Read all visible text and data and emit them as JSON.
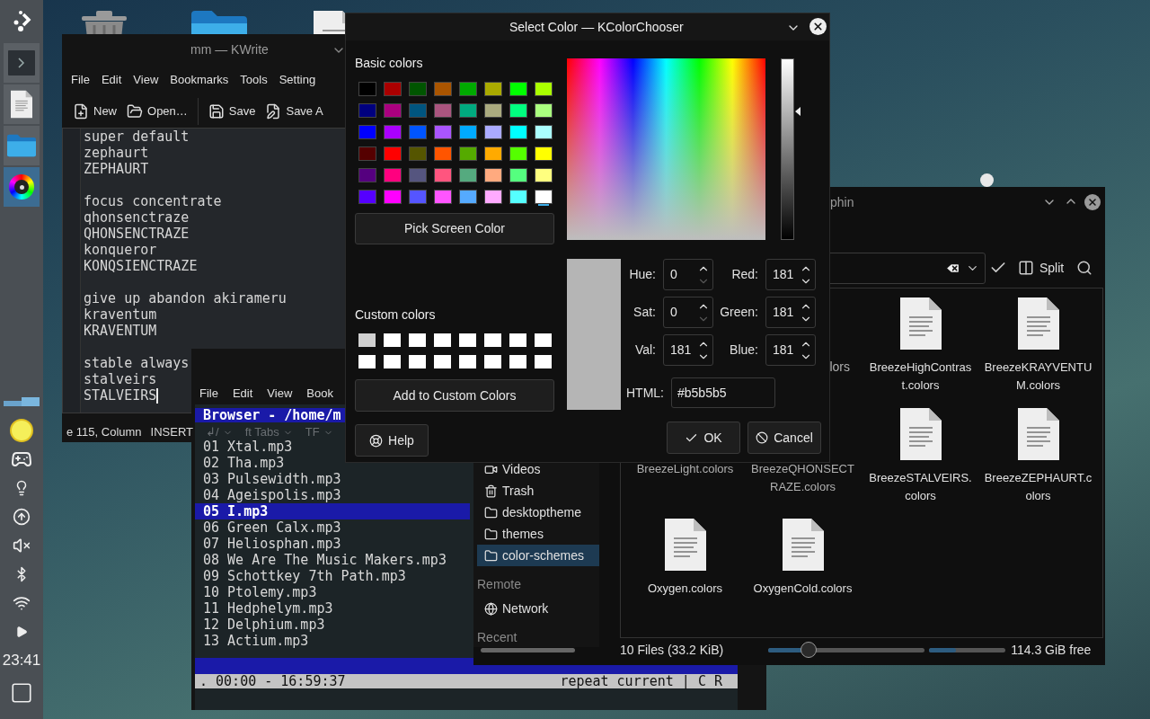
{
  "desktop_icons": [
    {
      "kind": "trash"
    },
    {
      "kind": "folder"
    },
    {
      "kind": "document"
    }
  ],
  "panel": {
    "launchers": [
      {
        "kind": "terminal",
        "active": false
      },
      {
        "kind": "text-editor",
        "active": false
      },
      {
        "kind": "folder",
        "active": false
      },
      {
        "kind": "color-chooser",
        "active": true
      }
    ],
    "tray": [
      {
        "kind": "meter"
      },
      {
        "kind": "night-light"
      },
      {
        "kind": "gamepad"
      },
      {
        "kind": "bulb"
      },
      {
        "kind": "update"
      },
      {
        "kind": "volume-muted"
      },
      {
        "kind": "bluetooth"
      },
      {
        "kind": "wifi"
      },
      {
        "kind": "expand"
      }
    ],
    "clock": "23:41"
  },
  "kwrite": {
    "title": "mm — KWrite",
    "menu": [
      "File",
      "Edit",
      "View",
      "Bookmarks",
      "Tools",
      "Setting"
    ],
    "toolbar": [
      {
        "kind": "new",
        "label": "New"
      },
      {
        "kind": "open",
        "label": "Open…"
      },
      {
        "kind": "save",
        "label": "Save"
      },
      {
        "kind": "save-as",
        "label": "Save A"
      }
    ],
    "paragraphs": [
      [
        "super default",
        "zephaurt",
        "ZEPHAURT"
      ],
      [
        "focus concentrate",
        "qhonsenctraze",
        "QHONSENCTRAZE",
        "konqueror",
        "KONQSIENCTRAZE"
      ],
      [
        "give up abandon akirameru",
        "kraventum",
        "KRAVENTUM"
      ],
      [
        "stable always",
        "stalveirs",
        "STALVEIRS"
      ]
    ],
    "status": [
      {
        "label": "e 115, Column",
        "dropdown": false
      },
      {
        "label": "INSERT",
        "dropdown": false
      },
      {
        "label": "↲/",
        "dropdown": true
      },
      {
        "label": "ft Tabs",
        "dropdown": true
      },
      {
        "label": "TF",
        "dropdown": true
      }
    ]
  },
  "terminal": {
    "menu": [
      "File",
      "Edit",
      "View",
      "Book"
    ],
    "header": "Browser - /home/m",
    "tracks": [
      {
        "label": "01 Xtal.mp3",
        "selected": false
      },
      {
        "label": "02 Tha.mp3",
        "selected": false
      },
      {
        "label": "03 Pulsewidth.mp3",
        "selected": false
      },
      {
        "label": "04 Ageispolis.mp3",
        "selected": false
      },
      {
        "label": "05 I.mp3",
        "selected": true
      },
      {
        "label": "06 Green Calx.mp3",
        "selected": false
      },
      {
        "label": "07 Heliosphan.mp3",
        "selected": false
      },
      {
        "label": "08 We Are The Music Makers.mp3",
        "selected": false
      },
      {
        "label": "09 Schottkey 7th Path.mp3",
        "selected": false
      },
      {
        "label": "10 Ptolemy.mp3",
        "selected": false
      },
      {
        "label": "11 Hedphelym.mp3",
        "selected": false
      },
      {
        "label": "12 Delphium.mp3",
        "selected": false
      },
      {
        "label": "13 Actium.mp3",
        "selected": false
      }
    ],
    "status_left": ". 00:00 - 16:59:37",
    "status_right": "repeat current | C R"
  },
  "dolphin": {
    "title": "phin",
    "split": "Split",
    "sidebar": [
      {
        "kind": "video",
        "label": "Videos",
        "selected": false
      },
      {
        "kind": "trash",
        "label": "Trash",
        "selected": false
      },
      {
        "kind": "folder",
        "label": "desktoptheme",
        "selected": false
      },
      {
        "kind": "folder",
        "label": "themes",
        "selected": false
      },
      {
        "kind": "folder",
        "label": "color-schemes",
        "selected": true
      },
      {
        "kind": "heading",
        "label": "Remote"
      },
      {
        "kind": "network",
        "label": "Network",
        "selected": false
      },
      {
        "kind": "heading",
        "label": "Recent"
      }
    ],
    "files": [
      {
        "kind": "label-tail",
        "label": "lors"
      },
      {
        "kind": "file",
        "label": "BreezeHighContrast.colors"
      },
      {
        "kind": "file",
        "label": "BreezeKRAYVENTUM.colors"
      },
      {
        "kind": "label",
        "label": "BreezeLight.colors"
      },
      {
        "kind": "label",
        "label": "BreezeQHONSECTRAZE.colors"
      },
      {
        "kind": "file",
        "label": "BreezeSTALVEIRS.colors"
      },
      {
        "kind": "file",
        "label": "BreezeZEPHAURT.colors"
      },
      {
        "kind": "file",
        "label": "Oxygen.colors"
      },
      {
        "kind": "file",
        "label": "OxygenCold.colors"
      }
    ],
    "status": "10 Files (33.2 KiB)",
    "zoom": {
      "level": 0.26
    },
    "space": {
      "level": 0.35
    },
    "free": "114.3 GiB free"
  },
  "color_dialog": {
    "title": "Select Color — KColorChooser",
    "basic_label": "Basic colors",
    "basic_colors": [
      {
        "color": "#000000",
        "selected": false
      },
      {
        "color": "#aa0000",
        "selected": false
      },
      {
        "color": "#005500",
        "selected": false
      },
      {
        "color": "#aa5500",
        "selected": false
      },
      {
        "color": "#00aa00",
        "selected": false
      },
      {
        "color": "#aaaa00",
        "selected": false
      },
      {
        "color": "#00ff00",
        "selected": false
      },
      {
        "color": "#aaff00",
        "selected": false
      },
      {
        "color": "#00007f",
        "selected": false
      },
      {
        "color": "#aa007f",
        "selected": false
      },
      {
        "color": "#00557f",
        "selected": false
      },
      {
        "color": "#aa557f",
        "selected": false
      },
      {
        "color": "#00aa7f",
        "selected": false
      },
      {
        "color": "#aaaa7f",
        "selected": false
      },
      {
        "color": "#00ff7f",
        "selected": false
      },
      {
        "color": "#aaff7f",
        "selected": false
      },
      {
        "color": "#0000ff",
        "selected": false
      },
      {
        "color": "#aa00ff",
        "selected": false
      },
      {
        "color": "#0055ff",
        "selected": false
      },
      {
        "color": "#aa55ff",
        "selected": false
      },
      {
        "color": "#00aaff",
        "selected": false
      },
      {
        "color": "#aaaaff",
        "selected": false
      },
      {
        "color": "#00ffff",
        "selected": false
      },
      {
        "color": "#aaffff",
        "selected": false
      },
      {
        "color": "#550000",
        "selected": false
      },
      {
        "color": "#ff0000",
        "selected": false
      },
      {
        "color": "#555500",
        "selected": false
      },
      {
        "color": "#ff5500",
        "selected": false
      },
      {
        "color": "#55aa00",
        "selected": false
      },
      {
        "color": "#ffaa00",
        "selected": false
      },
      {
        "color": "#55ff00",
        "selected": false
      },
      {
        "color": "#ffff00",
        "selected": false
      },
      {
        "color": "#55007f",
        "selected": false
      },
      {
        "color": "#ff007f",
        "selected": false
      },
      {
        "color": "#55557f",
        "selected": false
      },
      {
        "color": "#ff557f",
        "selected": false
      },
      {
        "color": "#55aa7f",
        "selected": false
      },
      {
        "color": "#ffaa7f",
        "selected": false
      },
      {
        "color": "#55ff7f",
        "selected": false
      },
      {
        "color": "#ffff7f",
        "selected": false
      },
      {
        "color": "#5500ff",
        "selected": false
      },
      {
        "color": "#ff00ff",
        "selected": false
      },
      {
        "color": "#5555ff",
        "selected": false
      },
      {
        "color": "#ff55ff",
        "selected": false
      },
      {
        "color": "#55aaff",
        "selected": false
      },
      {
        "color": "#ffaaff",
        "selected": false
      },
      {
        "color": "#55ffff",
        "selected": false
      },
      {
        "color": "#ffffff",
        "selected": true
      }
    ],
    "pick_button": "Pick Screen Color",
    "custom_label": "Custom colors",
    "custom_colors": [
      {
        "color": "#d0d0d0"
      },
      {
        "color": "#ffffff"
      },
      {
        "color": "#ffffff"
      },
      {
        "color": "#ffffff"
      },
      {
        "color": "#ffffff"
      },
      {
        "color": "#ffffff"
      },
      {
        "color": "#ffffff"
      },
      {
        "color": "#ffffff"
      },
      {
        "color": "#ffffff"
      },
      {
        "color": "#ffffff"
      },
      {
        "color": "#ffffff"
      },
      {
        "color": "#ffffff"
      },
      {
        "color": "#ffffff"
      },
      {
        "color": "#ffffff"
      },
      {
        "color": "#ffffff"
      },
      {
        "color": "#ffffff"
      }
    ],
    "add_button": "Add to Custom Colors",
    "help_button": "Help",
    "value_slider": {
      "level": 0.71
    },
    "fields": [
      {
        "label": "Hue:",
        "value": "0",
        "down_disabled": true
      },
      {
        "label": "Red:",
        "value": "181",
        "down_disabled": false
      },
      {
        "label": "Sat:",
        "value": "0",
        "down_disabled": true
      },
      {
        "label": "Green:",
        "value": "181",
        "down_disabled": false
      },
      {
        "label": "Val:",
        "value": "181",
        "down_disabled": false
      },
      {
        "label": "Blue:",
        "value": "181",
        "down_disabled": false
      }
    ],
    "html": {
      "label": "HTML:",
      "value": "#b5b5b5"
    },
    "ok": "OK",
    "cancel": "Cancel"
  }
}
